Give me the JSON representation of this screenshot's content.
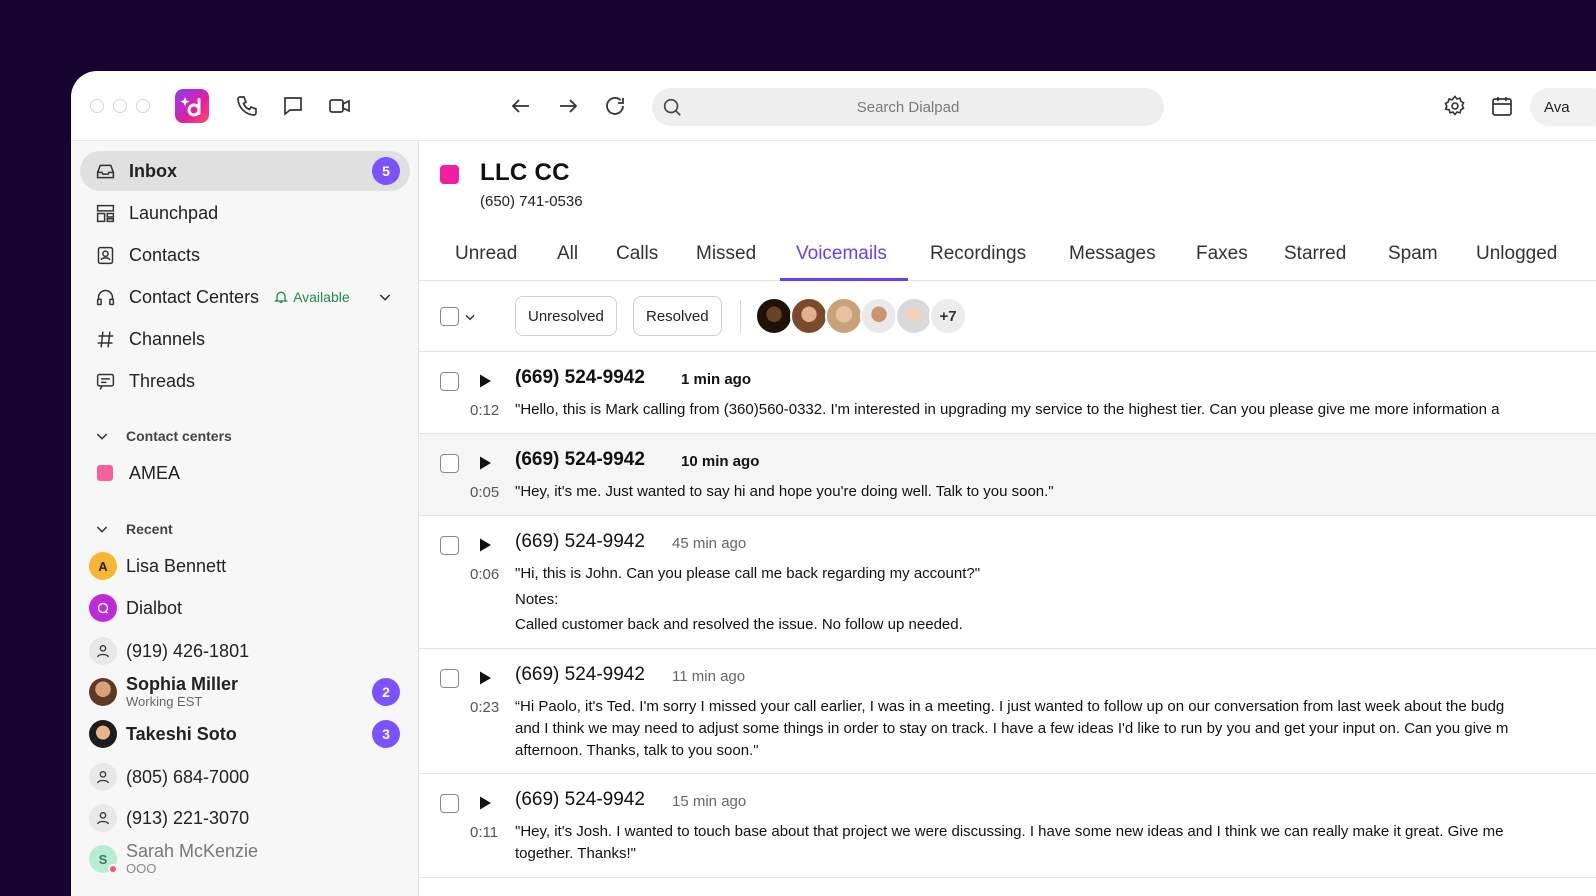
{
  "search": {
    "placeholder": "Search Dialpad"
  },
  "topbar": {
    "status_label": "Ava"
  },
  "sidebar": {
    "nav": [
      {
        "label": "Inbox",
        "badge": "5"
      },
      {
        "label": "Launchpad"
      },
      {
        "label": "Contacts"
      },
      {
        "label": "Contact Centers",
        "status": "Available"
      },
      {
        "label": "Channels"
      },
      {
        "label": "Threads"
      }
    ],
    "contact_centers_header": "Contact centers",
    "contact_centers": [
      {
        "label": "AMEA",
        "color": "#f5609c"
      }
    ],
    "recent_header": "Recent",
    "recent": [
      {
        "name": "Lisa Bennett",
        "initial": "A"
      },
      {
        "name": "Dialbot"
      },
      {
        "name": "(919) 426-1801"
      },
      {
        "name": "Sophia Miller",
        "sub": "Working EST",
        "badge": "2"
      },
      {
        "name": "Takeshi Soto",
        "badge": "3"
      },
      {
        "name": "(805) 684-7000"
      },
      {
        "name": "(913) 221-3070"
      },
      {
        "name": "Sarah McKenzie",
        "sub": "OOO",
        "initial": "S"
      }
    ]
  },
  "contact_center": {
    "name": "LLC CC",
    "phone": "(650) 741-0536",
    "color": "#f01ea0"
  },
  "tabs": [
    "Unread",
    "All",
    "Calls",
    "Missed",
    "Voicemails",
    "Recordings",
    "Messages",
    "Faxes",
    "Starred",
    "Spam",
    "Unlogged"
  ],
  "active_tab": "Voicemails",
  "filters": {
    "unresolved": "Unresolved",
    "resolved": "Resolved",
    "more_agents": "+7"
  },
  "voicemails": [
    {
      "number": "(669) 524-9942",
      "time": "1 min ago",
      "duration": "0:12",
      "unread": true,
      "lines": [
        "\"Hello, this is Mark calling from (360)560-0332. I'm interested in upgrading my service to the highest tier. Can you please give me more information a"
      ]
    },
    {
      "number": "(669) 524-9942",
      "time": "10 min ago",
      "duration": "0:05",
      "unread": true,
      "lines": [
        "\"Hey, it's me. Just wanted to say hi and hope you're doing well. Talk to you soon.\""
      ]
    },
    {
      "number": "(669) 524-9942",
      "time": "45 min ago",
      "duration": "0:06",
      "unread": false,
      "lines": [
        "\"Hi, this is John. Can you please call me back regarding my account?\""
      ],
      "notes_label": "Notes:",
      "notes": "Called customer back and resolved the issue. No follow up needed."
    },
    {
      "number": "(669) 524-9942",
      "time": "11 min ago",
      "duration": "0:23",
      "unread": false,
      "lines": [
        "“Hi Paolo, it's Ted. I'm sorry I missed your call earlier, I was in a meeting. I just wanted to follow up on our conversation from last week about the budg",
        "and I think we may need to adjust some things in order to stay on track. I have a few ideas I'd like to run by you and get your input on. Can you give m",
        "afternoon. Thanks, talk to you soon.\""
      ]
    },
    {
      "number": "(669) 524-9942",
      "time": "15 min ago",
      "duration": "0:11",
      "unread": false,
      "lines": [
        "\"Hey, it's Josh. I wanted to touch base about that project we were discussing. I have some new ideas and I think we can really make it great. Give me",
        "together. Thanks!\""
      ]
    }
  ]
}
